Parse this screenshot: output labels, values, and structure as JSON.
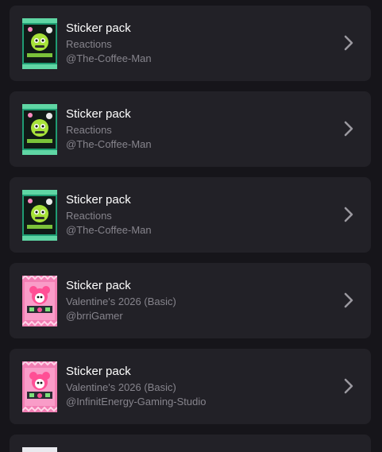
{
  "colors": {
    "page_bg": "#16151a",
    "card_bg": "#222127",
    "title": "#ffffff",
    "subtitle": "#86848c",
    "chevron": "#9b99a0"
  },
  "packs": [
    {
      "title": "Sticker pack",
      "collection": "Reactions",
      "author": "@The-Coffee-Man",
      "theme": "green",
      "icon": "chevron-right-icon"
    },
    {
      "title": "Sticker pack",
      "collection": "Reactions",
      "author": "@The-Coffee-Man",
      "theme": "green",
      "icon": "chevron-right-icon"
    },
    {
      "title": "Sticker pack",
      "collection": "Reactions",
      "author": "@The-Coffee-Man",
      "theme": "green",
      "icon": "chevron-right-icon"
    },
    {
      "title": "Sticker pack",
      "collection": "Valentine's 2026 (Basic)",
      "author": "@brriGamer",
      "theme": "pink",
      "icon": "chevron-right-icon"
    },
    {
      "title": "Sticker pack",
      "collection": "Valentine's 2026 (Basic)",
      "author": "@InfinitEnergy-Gaming-Studio",
      "theme": "pink",
      "icon": "chevron-right-icon"
    }
  ]
}
